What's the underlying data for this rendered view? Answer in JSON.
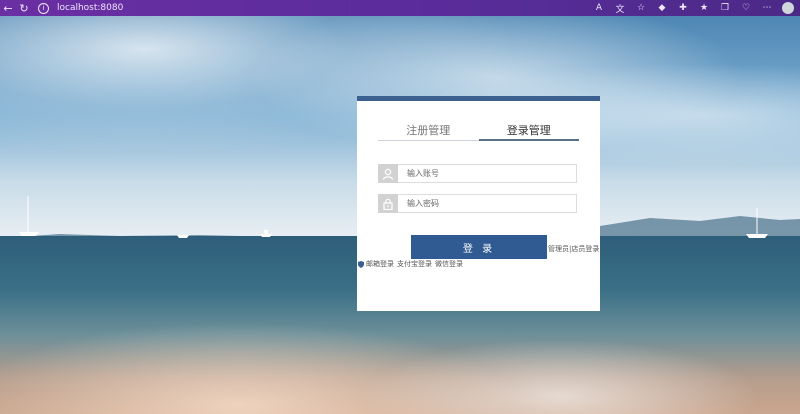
{
  "browser": {
    "url": "localhost:8080",
    "icons": [
      "back-arrow-icon",
      "refresh-icon",
      "info-icon",
      "read-aloud-icon",
      "translate-icon",
      "favorite-star-icon",
      "extension-icon",
      "puzzle-icon",
      "favorites-icon",
      "collections-icon",
      "notifications-icon",
      "more-icon",
      "profile-avatar-icon"
    ]
  },
  "login": {
    "tabs": [
      {
        "label": "注册管理",
        "active": false
      },
      {
        "label": "登录管理",
        "active": true
      }
    ],
    "account_placeholder": "输入账号",
    "password_placeholder": "输入密码",
    "submit_label": "登 录",
    "role_links": "管理员|店员登录",
    "alt_logins": [
      {
        "label": "邮箱登录"
      },
      {
        "label": "支付宝登录"
      },
      {
        "label": "微信登录"
      }
    ]
  },
  "colors": {
    "accent": "#2f5b92",
    "card_top_bar": "#3b5f8f",
    "browser_chrome": "#5a2c9b"
  }
}
